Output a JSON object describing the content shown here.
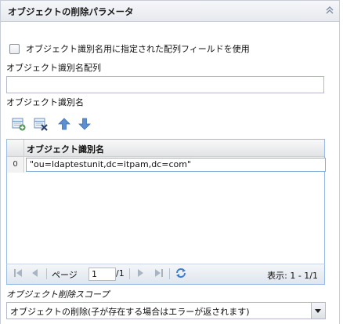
{
  "panel": {
    "title": "オブジェクトの削除パラメータ",
    "collapse_icon": "double-chevron-up-icon"
  },
  "checkbox": {
    "label": "オブジェクト識別名用に指定された配列フィールドを使用",
    "checked": false
  },
  "array_field": {
    "label": "オブジェクト識別名配列",
    "value": ""
  },
  "dn_section": {
    "label": "オブジェクト識別名"
  },
  "toolbar": {
    "add_icon": "add-row-icon",
    "delete_icon": "delete-row-icon",
    "move_up_icon": "arrow-up-icon",
    "move_down_icon": "arrow-down-icon"
  },
  "grid": {
    "column_header": "オブジェクト識別名",
    "rows": [
      {
        "num": "0",
        "value": "\"ou=ldaptestunit,dc=itpam,dc=com\""
      }
    ]
  },
  "paging": {
    "page_label": "ページ",
    "current_page": "1",
    "total_pages": "/1",
    "display_info": "表示: 1 - 1/1"
  },
  "scope": {
    "label": "オブジェクト削除スコープ",
    "selected": "オブジェクトの削除(子が存在する場合はエラーが返されます)"
  },
  "colors": {
    "grid_border": "#99bbe8",
    "icon_blue": "#5b8fd0"
  }
}
